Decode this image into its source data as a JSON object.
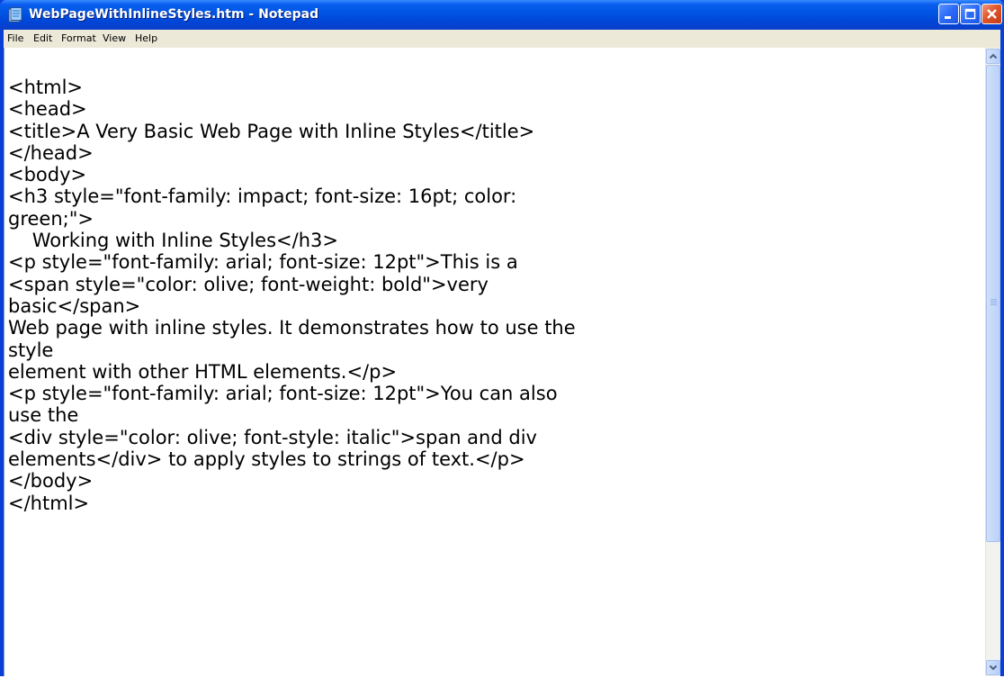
{
  "window": {
    "title": "WebPageWithInlineStyles.htm - Notepad",
    "icon": "notepad-icon",
    "controls": [
      "minimize-icon",
      "maximize-icon",
      "close-icon"
    ]
  },
  "menu": [
    "File",
    "Edit",
    "Format",
    "View",
    "Help"
  ],
  "editor": {
    "lines": [
      "<html>",
      "<head>",
      "<title>A Very Basic Web Page with Inline Styles</title>",
      "</head>",
      "<body>",
      "<h3 style=\"font-family: impact; font-size: 16pt; color:",
      "green;\">",
      "    Working with Inline Styles</h3>",
      "<p style=\"font-family: arial; font-size: 12pt\">This is a",
      "<span style=\"color: olive; font-weight: bold\">very",
      "basic</span>",
      "Web page with inline styles. It demonstrates how to use the",
      "style",
      "element with other HTML elements.</p>",
      "<p style=\"font-family: arial; font-size: 12pt\">You can also",
      "use the",
      "<div style=\"color: olive; font-style: italic\">span and div",
      "elements</div> to apply styles to strings of text.</p>",
      "</body>",
      "</html>"
    ]
  },
  "scrollbar": {
    "up_icon": "scroll-up-arrow-icon",
    "down_icon": "scroll-down-arrow-icon"
  },
  "colors": {
    "titlebar": "#0054e3",
    "menubar": "#ece9d8",
    "close_button": "#e0562c"
  }
}
